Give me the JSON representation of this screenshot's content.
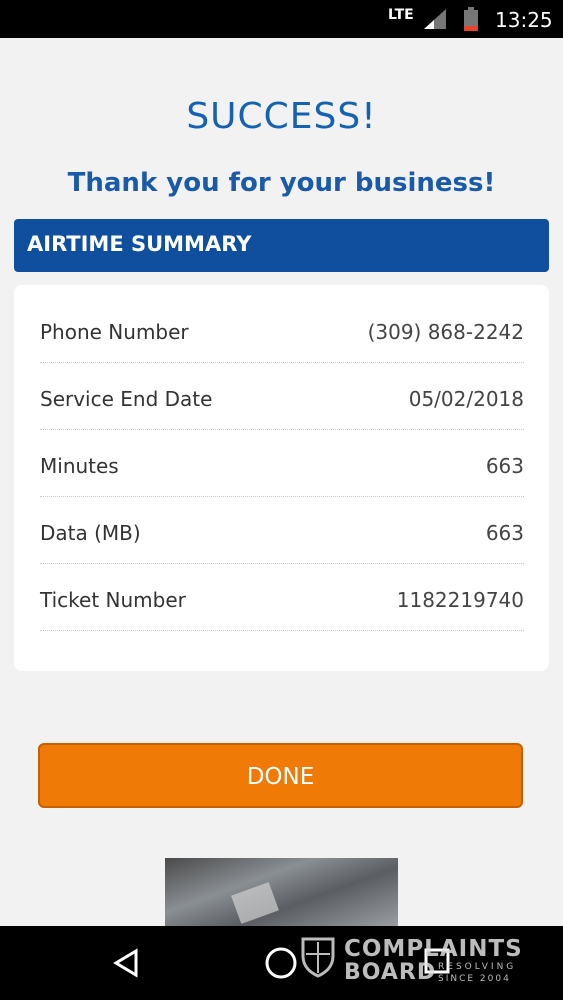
{
  "status_bar": {
    "network": "LTE",
    "time": "13:25"
  },
  "page": {
    "title": "SUCCESS!",
    "subtitle": "Thank you for your business!"
  },
  "summary": {
    "header": "AIRTIME SUMMARY",
    "rows": [
      {
        "label": "Phone Number",
        "value": "(309) 868-2242"
      },
      {
        "label": "Service End Date",
        "value": "05/02/2018"
      },
      {
        "label": "Minutes",
        "value": "663"
      },
      {
        "label": "Data (MB)",
        "value": "663"
      },
      {
        "label": "Ticket Number",
        "value": "1182219740"
      }
    ]
  },
  "actions": {
    "done_label": "DONE"
  },
  "watermark": {
    "line1": "COMPLAINTS",
    "line2": "BOARD",
    "tag1": "RESOLVING",
    "tag2": "SINCE 2004"
  },
  "colors": {
    "primary_blue": "#0f4f9e",
    "accent_orange": "#f07a06",
    "background": "#f2f2f2"
  }
}
